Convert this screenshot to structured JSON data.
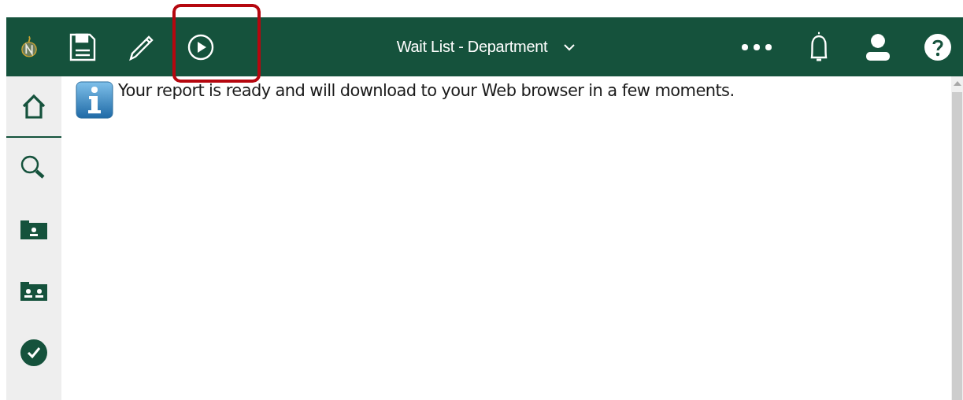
{
  "header": {
    "title": "Wait List - Department"
  },
  "sidebar": {
    "items": [
      {
        "kind": "home",
        "selected": true
      },
      {
        "kind": "search",
        "selected": false
      },
      {
        "kind": "folder-person",
        "selected": false
      },
      {
        "kind": "folder-people",
        "selected": false
      },
      {
        "kind": "check",
        "selected": false
      }
    ]
  },
  "message": {
    "text": "Your report is ready and will download to your Web browser in a few moments."
  }
}
